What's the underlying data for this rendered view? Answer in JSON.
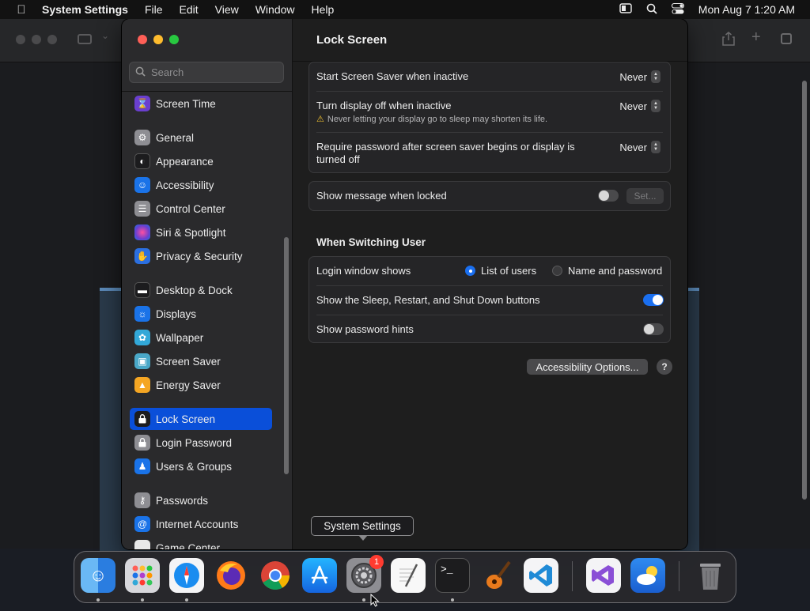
{
  "menubar": {
    "app_name": "System Settings",
    "menus": [
      "File",
      "Edit",
      "View",
      "Window",
      "Help"
    ],
    "clock": "Mon Aug 7  1:20 AM",
    "status_icons": [
      "window-icon",
      "search-icon",
      "control-center-icon"
    ]
  },
  "sidebar": {
    "search_placeholder": "Search",
    "items": [
      {
        "label": "Screen Time",
        "icon": "hourglass-icon",
        "color": "#6a3fcf"
      },
      {
        "label": "General",
        "icon": "gear-icon",
        "color": "#8e8e93"
      },
      {
        "label": "Appearance",
        "icon": "appearance-icon",
        "color": "#1c1c1e"
      },
      {
        "label": "Accessibility",
        "icon": "accessibility-icon",
        "color": "#1a73e8"
      },
      {
        "label": "Control Center",
        "icon": "control-center-icon",
        "color": "#8e8e93"
      },
      {
        "label": "Siri & Spotlight",
        "icon": "siri-icon",
        "color": "#b03fcf"
      },
      {
        "label": "Privacy & Security",
        "icon": "hand-icon",
        "color": "#2b6fe0"
      },
      {
        "label": "Desktop & Dock",
        "icon": "desktop-icon",
        "color": "#1c1c1e"
      },
      {
        "label": "Displays",
        "icon": "sun-icon",
        "color": "#1a73e8"
      },
      {
        "label": "Wallpaper",
        "icon": "wallpaper-icon",
        "color": "#32a8d8"
      },
      {
        "label": "Screen Saver",
        "icon": "screen-saver-icon",
        "color": "#4aa8c8"
      },
      {
        "label": "Energy Saver",
        "icon": "battery-icon",
        "color": "#f5a623"
      },
      {
        "label": "Lock Screen",
        "icon": "lock-icon",
        "color": "#1c1c1e"
      },
      {
        "label": "Login Password",
        "icon": "lock-icon",
        "color": "#8e8e93"
      },
      {
        "label": "Users & Groups",
        "icon": "users-icon",
        "color": "#1a73e8"
      },
      {
        "label": "Passwords",
        "icon": "key-icon",
        "color": "#8e8e93"
      },
      {
        "label": "Internet Accounts",
        "icon": "at-icon",
        "color": "#1a73e8"
      },
      {
        "label": "Game Center",
        "icon": "game-center-icon",
        "color": "#e8e8e8"
      }
    ],
    "selected": "Lock Screen"
  },
  "content": {
    "title": "Lock Screen",
    "screen_saver_row": {
      "label": "Start Screen Saver when inactive",
      "value": "Never"
    },
    "display_off_row": {
      "label": "Turn display off when inactive",
      "value": "Never",
      "warning": "Never letting your display go to sleep may shorten its life."
    },
    "require_password_row": {
      "label_line1": "Require password after screen saver begins or display is",
      "label_line2": "turned off",
      "value": "Never"
    },
    "show_message_row": {
      "label": "Show message when locked",
      "toggle": "off",
      "set_button": "Set..."
    },
    "switching_heading": "When Switching User",
    "login_window_row": {
      "label": "Login window shows",
      "option_list": "List of users",
      "option_name": "Name and password",
      "selected": "List of users"
    },
    "sleep_buttons_row": {
      "label": "Show the Sleep, Restart, and Shut Down buttons",
      "toggle": "on"
    },
    "password_hints_row": {
      "label": "Show password hints",
      "toggle": "off"
    },
    "accessibility_button": "Accessibility Options...",
    "help_button": "?"
  },
  "tooltip": "System Settings",
  "dock": {
    "badge": "1",
    "apps": [
      "Finder",
      "Launchpad",
      "Safari",
      "Firefox",
      "Chrome",
      "App Store",
      "System Settings",
      "TextEdit",
      "Terminal",
      "GarageBand",
      "Visual Studio Code",
      "Visual Studio",
      "Weather",
      "Trash"
    ]
  }
}
